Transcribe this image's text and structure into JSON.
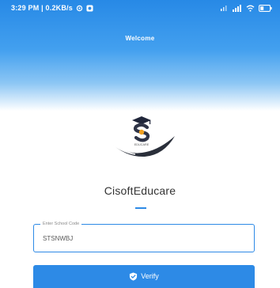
{
  "status_bar": {
    "time_and_speed": "3:29 PM | 0.2KB/s",
    "icons": [
      "settings-icon",
      "app-notification-icon",
      "volte-icon",
      "signal-icon",
      "wifi-icon",
      "battery-icon"
    ]
  },
  "header": {
    "welcome": "Welcome",
    "gradient_top_color": "#2789e6"
  },
  "logo": {
    "caption": "EDUCARE"
  },
  "app": {
    "title": "CisoftEducare",
    "accent_color": "#2d8ae6"
  },
  "school_code_field": {
    "label": "Enter School Code",
    "value": "STSNWBJ"
  },
  "verify_button": {
    "label": "Verify",
    "icon": "shield-check-icon"
  }
}
